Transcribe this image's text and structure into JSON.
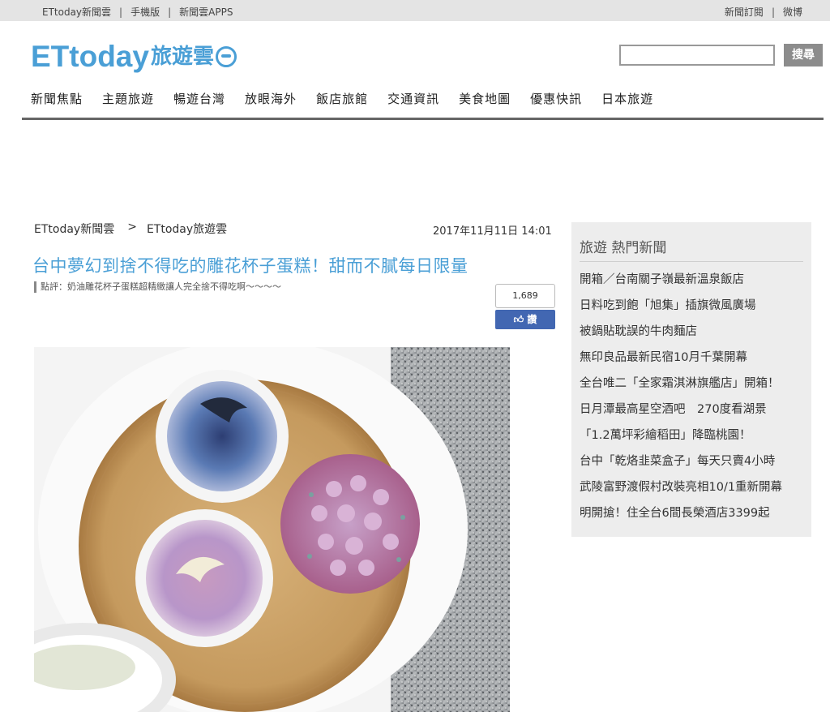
{
  "topbar": {
    "left_links": [
      "ETtoday新聞雲",
      "手機版",
      "新聞雲APPS"
    ],
    "right_links": [
      "新聞訂閱",
      "微博"
    ]
  },
  "logo": {
    "brand": "ETtoday",
    "section": "旅遊雲"
  },
  "search": {
    "placeholder": "",
    "button_label": "搜尋"
  },
  "nav": {
    "items": [
      "新聞焦點",
      "主題旅遊",
      "暢遊台灣",
      "放眼海外",
      "飯店旅館",
      "交通資訊",
      "美食地圖",
      "優惠快訊",
      "日本旅遊"
    ]
  },
  "article": {
    "breadcrumb": [
      "ETtoday新聞雲",
      "ETtoday旅遊雲"
    ],
    "breadcrumb_separator": ">",
    "date": "2017年11月11日 14:01",
    "title": "台中夢幻到捨不得吃的雕花杯子蛋糕！甜而不膩每日限量",
    "subtitle": "點評：奶油雕花杯子蛋糕超精緻讓人完全捨不得吃啊～～～～",
    "facebook": {
      "count": "1,689",
      "like_label": "讚"
    }
  },
  "sidebar": {
    "heading": "旅遊 熱門新聞",
    "items": [
      "開箱／台南關子嶺最新溫泉飯店",
      "日料吃到飽「旭集」插旗微風廣場",
      "被鍋貼耽誤的牛肉麵店",
      "無印良品最新民宿10月千葉開幕",
      "全台唯二「全家霜淇淋旗艦店」開箱！",
      "日月潭最高星空酒吧　270度看湖景",
      "「1.2萬坪彩繪稻田」降臨桃園！",
      "台中「乾烙韭菜盒子」每天只賣4小時",
      "武陵富野渡假村改裝亮相10/1重新開幕",
      "明開搶！住全台6間長榮酒店3399起"
    ]
  },
  "colors": {
    "accent": "#4a9fd6",
    "facebook": "#4267b2",
    "topbar_bg": "#e4e4e4",
    "sidebar_bg": "#ededed"
  }
}
